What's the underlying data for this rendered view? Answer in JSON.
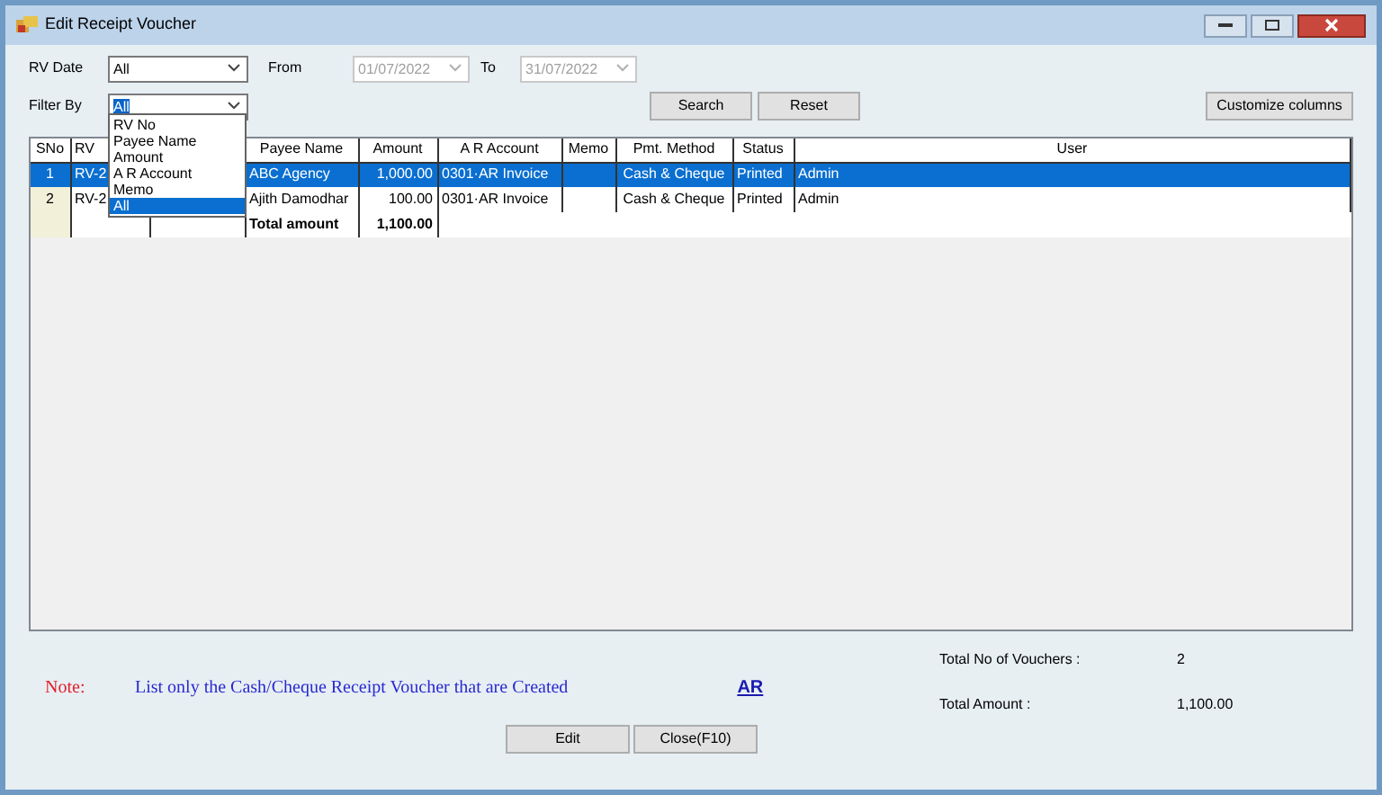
{
  "window": {
    "title": "Edit Receipt Voucher"
  },
  "filters": {
    "rv_date_label": "RV Date",
    "rv_date_value": "All",
    "from_label": "From",
    "from_value": "01/07/2022",
    "from_disabled": true,
    "to_label": "To",
    "to_value": "31/07/2022",
    "to_disabled": true,
    "filter_by_label": "Filter By",
    "filter_by_value": "All"
  },
  "filter_dropdown": {
    "options": [
      {
        "label": "RV No",
        "selected": false
      },
      {
        "label": "Payee Name",
        "selected": false
      },
      {
        "label": "Amount",
        "selected": false
      },
      {
        "label": "A R Account",
        "selected": false
      },
      {
        "label": "Memo",
        "selected": false
      },
      {
        "label": "All",
        "selected": true
      }
    ]
  },
  "buttons": {
    "search": "Search",
    "reset": "Reset",
    "customize": "Customize columns"
  },
  "table": {
    "columns": [
      "SNo",
      "RV",
      "",
      "Payee Name",
      "Amount",
      "A R Account",
      "Memo",
      "Pmt. Method",
      "Status",
      "User"
    ],
    "rows": [
      {
        "cells": [
          "1",
          "RV-2",
          "",
          "ABC Agency",
          "1,000.00",
          "0301·AR Invoice",
          "",
          "Cash & Cheque",
          "Printed",
          "Admin"
        ],
        "selected": true
      },
      {
        "cells": [
          "2",
          "RV-2",
          "",
          "Ajith Damodhar",
          "100.00",
          "0301·AR Invoice",
          "",
          "Cash & Cheque",
          "Printed",
          "Admin"
        ],
        "selected": false
      }
    ],
    "total": {
      "label": "Total amount",
      "value": "1,100.00"
    }
  },
  "note": {
    "label": "Note:",
    "text": "List only the Cash/Cheque Receipt Voucher that are Created",
    "link": "AR"
  },
  "summary": [
    {
      "label": "Total No of Vouchers :",
      "value": "2"
    },
    {
      "label": "Total Amount :",
      "value": "1,100.00"
    }
  ],
  "footer_buttons": [
    "Edit",
    "Close(F10)"
  ]
}
